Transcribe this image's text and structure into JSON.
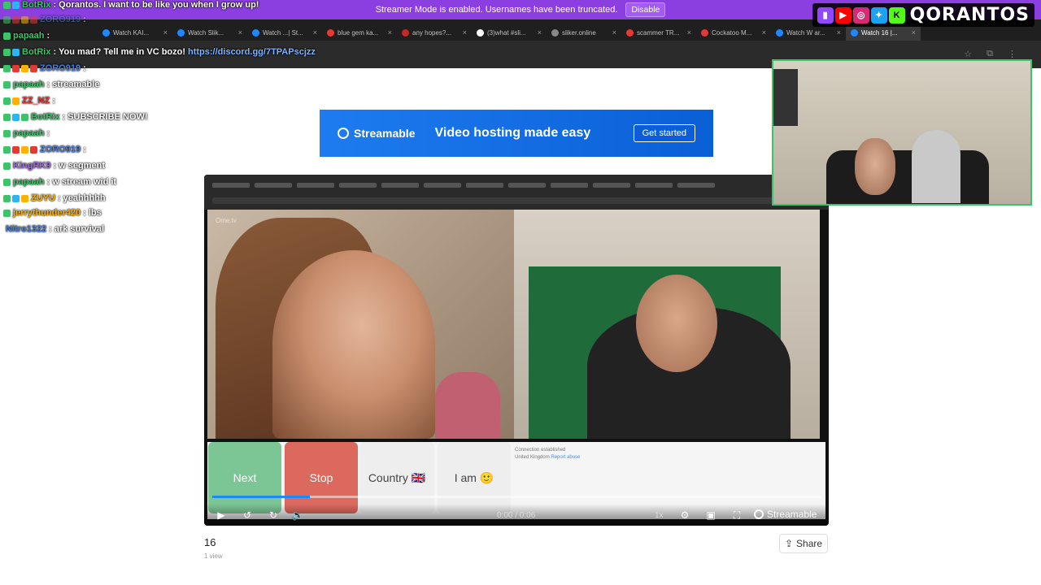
{
  "browser": {
    "streamer_notice": "Streamer Mode is enabled. Usernames have been truncated.",
    "disable_label": "Disable",
    "tabs": [
      {
        "label": "Watch KAI...",
        "color": "#1e88ff"
      },
      {
        "label": "Watch Slik...",
        "color": "#1e88ff"
      },
      {
        "label": "Watch ...| St...",
        "color": "#1e88ff"
      },
      {
        "label": "blue gem ka...",
        "color": "#e53935"
      },
      {
        "label": "any hopes?...",
        "color": "#c62828"
      },
      {
        "label": "(3)what #sli...",
        "color": "#ffffff"
      },
      {
        "label": "sliker.online",
        "color": "#888888"
      },
      {
        "label": "scammer TR...",
        "color": "#e53935"
      },
      {
        "label": "Cockatoo M...",
        "color": "#e53935"
      },
      {
        "label": "Watch W ar...",
        "color": "#1e88ff"
      },
      {
        "label": "Watch 16 |...",
        "color": "#1e88ff",
        "active": true
      }
    ],
    "close_glyph": "×"
  },
  "overlay": {
    "channel_name": "QORANTOS",
    "social_icons": [
      "twitch-icon",
      "youtube-icon",
      "instagram-icon",
      "twitter-icon",
      "kick-icon"
    ]
  },
  "chat": {
    "lines": [
      {
        "user": "BotRix",
        "user_color": "#3ec26a",
        "msg": ": Qorantos. I want to be like you when I grow up!",
        "badges": [
          "#3ec26a",
          "#29b6f6"
        ]
      },
      {
        "user": "ZORO919",
        "user_color": "#4a7bd6",
        "msg": " :",
        "badges": [
          "#3ec26a",
          "#e53935",
          "#ffb300",
          "#e53935"
        ],
        "faded": true
      },
      {
        "user": "papaah",
        "user_color": "#3ec26a",
        "msg": " :",
        "badges": [
          "#3ec26a"
        ]
      },
      {
        "user": "BotRix",
        "user_color": "#3ec26a",
        "msg": ": You mad? Tell me in VC bozo!",
        "link": "https://discord.gg/7TPAPscjzz",
        "badges": [
          "#3ec26a",
          "#29b6f6"
        ]
      },
      {
        "user": "ZORO919",
        "user_color": "#4a7bd6",
        "msg": " :",
        "badges": [
          "#3ec26a",
          "#e53935",
          "#ffb300",
          "#e53935"
        ]
      },
      {
        "user": "papaah",
        "user_color": "#3ec26a",
        "msg": " : streamable",
        "badges": [
          "#3ec26a"
        ]
      },
      {
        "user": "ZZ_NZ",
        "user_color": "#e53935",
        "msg": " :",
        "badges": [
          "#3ec26a",
          "#ffb300"
        ]
      },
      {
        "user": "BotRix",
        "user_color": "#3ec26a",
        "msg": ": SUBSCRIBE NOW!",
        "badges": [
          "#3ec26a",
          "#29b6f6",
          "#3ec26a"
        ]
      },
      {
        "user": "papaah",
        "user_color": "#3ec26a",
        "msg": " :",
        "badges": [
          "#3ec26a"
        ]
      },
      {
        "user": "ZORO919",
        "user_color": "#4a7bd6",
        "msg": " :",
        "badges": [
          "#3ec26a",
          "#e53935",
          "#ffb300",
          "#e53935"
        ]
      },
      {
        "user": "KingRK9",
        "user_color": "#9c6ade",
        "msg": ": w segment",
        "badges": [
          "#3ec26a"
        ]
      },
      {
        "user": "papaah",
        "user_color": "#3ec26a",
        "msg": ": w stream wid it",
        "badges": [
          "#3ec26a"
        ]
      },
      {
        "user": "ZUYU",
        "user_color": "#ffb300",
        "msg": ": yeahhhhh",
        "badges": [
          "#3ec26a",
          "#29b6f6",
          "#ffb300"
        ]
      },
      {
        "user": "jerrythunder420",
        "user_color": "#ffb300",
        "msg": ": lbs",
        "badges": [
          "#3ec26a"
        ]
      },
      {
        "user": "Nitro1322",
        "user_color": "#4a7bd6",
        "msg": ": ark survival",
        "badges": []
      }
    ]
  },
  "banner": {
    "brand": "Streamable",
    "tagline": "Video hosting made easy",
    "cta": "Get started"
  },
  "player": {
    "ome_brand": "Ome.tv",
    "buttons": {
      "next": "Next",
      "stop": "Stop",
      "country": "Country",
      "country_flag": "🇬🇧",
      "iam": "I am",
      "iam_emoji": "🙂"
    },
    "ome_status_1": "Connection established",
    "ome_status_2": "United Kingdom",
    "ome_report": "Report abuse",
    "time": "0:00 / 0:06",
    "progress": 0.16,
    "speed": "1x",
    "brand": "Streamable"
  },
  "video": {
    "title": "16",
    "views": "1 view",
    "share_label": "Share"
  }
}
